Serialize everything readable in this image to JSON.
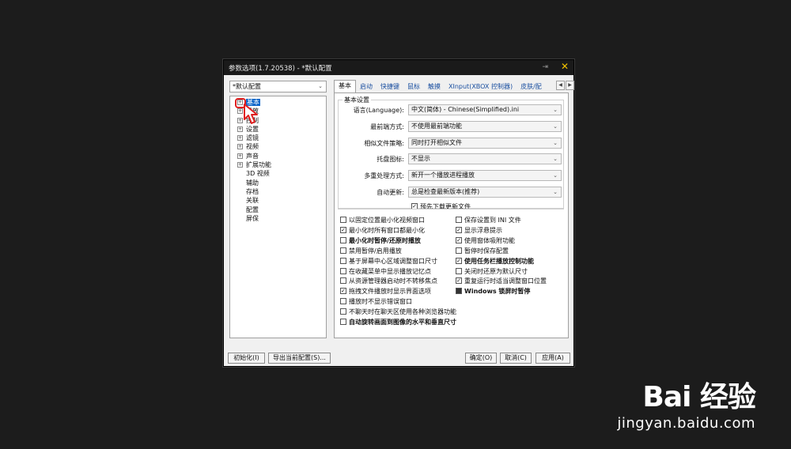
{
  "window": {
    "title": "参数选项(1.7.20538) - *默认配置",
    "pin_icon": "pin-icon",
    "close_icon": "close-icon"
  },
  "preset": {
    "value": "*默认配置"
  },
  "tree": {
    "items": [
      {
        "label": "基本",
        "selected": true,
        "expandable": true
      },
      {
        "label": "播放",
        "expandable": true
      },
      {
        "label": "控制",
        "expandable": true
      },
      {
        "label": "设置",
        "expandable": true
      },
      {
        "label": "滤镜",
        "expandable": true
      },
      {
        "label": "视频",
        "expandable": true
      },
      {
        "label": "声音",
        "expandable": true
      },
      {
        "label": "扩展功能",
        "expandable": true
      },
      {
        "label": "3D 视频",
        "expandable": false
      },
      {
        "label": "辅助",
        "expandable": false
      },
      {
        "label": "存档",
        "expandable": false
      },
      {
        "label": "关联",
        "expandable": false
      },
      {
        "label": "配置",
        "expandable": false
      },
      {
        "label": "屏保",
        "expandable": false
      }
    ]
  },
  "tabs": [
    "基本",
    "启动",
    "快捷键",
    "鼠标",
    "触摸",
    "XInput(XBOX 控制器)",
    "皮肤/配"
  ],
  "basic": {
    "group_title": "基本设置",
    "rows": [
      {
        "label": "语言(Language):",
        "value": "中文(简体) - Chinese(Simplified).ini"
      },
      {
        "label": "最前端方式:",
        "value": "不使用最前端功能"
      },
      {
        "label": "相似文件策略:",
        "value": "同时打开相似文件"
      },
      {
        "label": "托盘图标:",
        "value": "不显示"
      },
      {
        "label": "多重处理方式:",
        "value": "新开一个播放进程播放"
      },
      {
        "label": "自动更新:",
        "value": "总是检查最新版本(推荐)"
      }
    ],
    "predownload": "预先下载更新文件"
  },
  "options_left": [
    {
      "label": "以固定位置最小化视频窗口",
      "checked": false,
      "bold": false
    },
    {
      "label": "最小化时所有窗口都最小化",
      "checked": true,
      "bold": false
    },
    {
      "label": "最小化时暂停/还原时播放",
      "checked": false,
      "bold": true
    },
    {
      "label": "禁用暂停/启用播放",
      "checked": false,
      "bold": false
    },
    {
      "label": "基于屏幕中心区域调整窗口尺寸",
      "checked": false,
      "bold": false
    },
    {
      "label": "在收藏菜单中显示播放记忆点",
      "checked": false,
      "bold": false
    },
    {
      "label": "从资源管理器启动时不转移焦点",
      "checked": false,
      "bold": false
    },
    {
      "label": "拖拽文件播放时显示界面选项",
      "checked": true,
      "bold": false
    },
    {
      "label": "播放时不显示错误窗口",
      "checked": false,
      "bold": false
    },
    {
      "label": "不聊天时在聊天区使用各种浏览器功能",
      "checked": false,
      "bold": false
    },
    {
      "label": "自动旋转画面到图像的水平和垂直尺寸",
      "checked": false,
      "bold": true
    }
  ],
  "options_right": [
    {
      "label": "保存设置到 INI 文件",
      "checked": false,
      "bold": false
    },
    {
      "label": "显示浮悬提示",
      "checked": true,
      "bold": false
    },
    {
      "label": "使用窗体吸附功能",
      "checked": true,
      "bold": false
    },
    {
      "label": "暂停时保存配置",
      "checked": false,
      "bold": false
    },
    {
      "label": "使用任务栏播放控制功能",
      "checked": true,
      "bold": true
    },
    {
      "label": "关闭时还原为默认尺寸",
      "checked": false,
      "bold": false
    },
    {
      "label": "重复运行时适当调整窗口位置",
      "checked": true,
      "bold": false
    },
    {
      "label": "Windows 锁屏时暂停",
      "checked": true,
      "bold": true,
      "dark": true
    }
  ],
  "buttons": {
    "init": "初始化(I)",
    "export": "导出当前配置(S)...",
    "ok": "确定(O)",
    "cancel": "取消(C)",
    "apply": "应用(A)"
  },
  "watermark": {
    "logo": "Bai 经验",
    "url": "jingyan.baidu.com"
  }
}
